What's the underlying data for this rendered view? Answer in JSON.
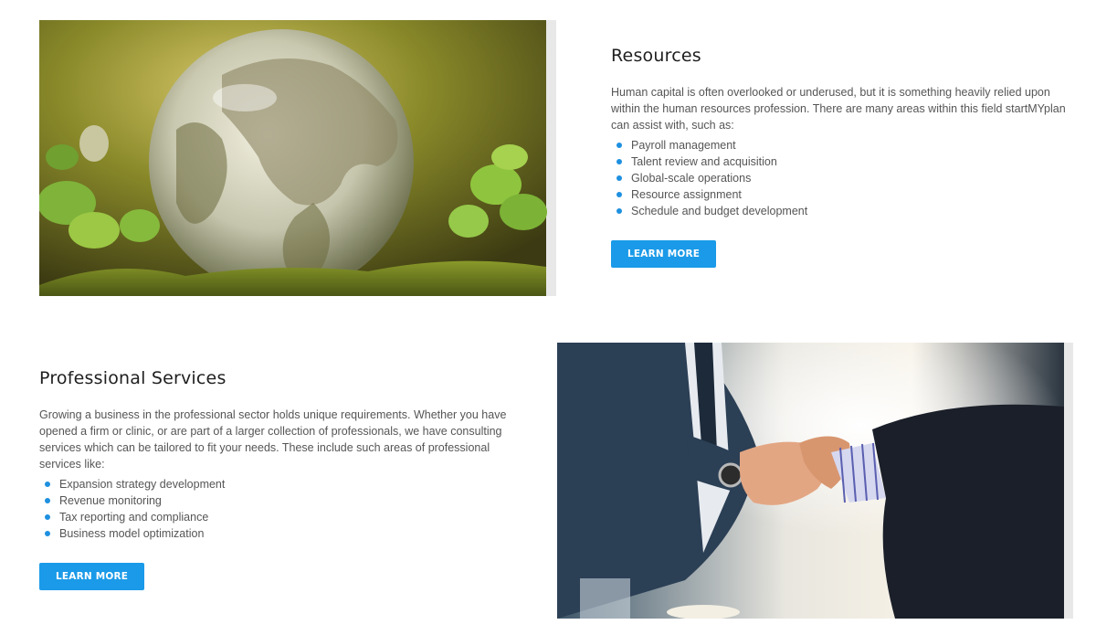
{
  "resources": {
    "title": "Resources",
    "description": "Human capital is often overlooked or underused, but it is something heavily relied upon within the human resources profession. There are many areas within this field startMYplan can assist with, such as:",
    "items": [
      "Payroll management",
      "Talent review and acquisition",
      "Global-scale operations",
      "Resource assignment",
      "Schedule and budget development"
    ],
    "button_label": "LEARN MORE"
  },
  "professional": {
    "title": "Professional Services",
    "description": "Growing a business in the professional sector holds unique requirements. Whether you have opened a firm or clinic, or are part of a larger collection of professionals, we have consulting services which can be tailored to fit your needs. These include such areas of professional services like:",
    "items": [
      "Expansion strategy development",
      "Revenue monitoring",
      "Tax reporting and compliance",
      "Business model optimization"
    ],
    "button_label": "LEARN MORE"
  },
  "colors": {
    "accent": "#1a9ae8",
    "heading": "#1f1f1f",
    "body_text": "#555555"
  }
}
